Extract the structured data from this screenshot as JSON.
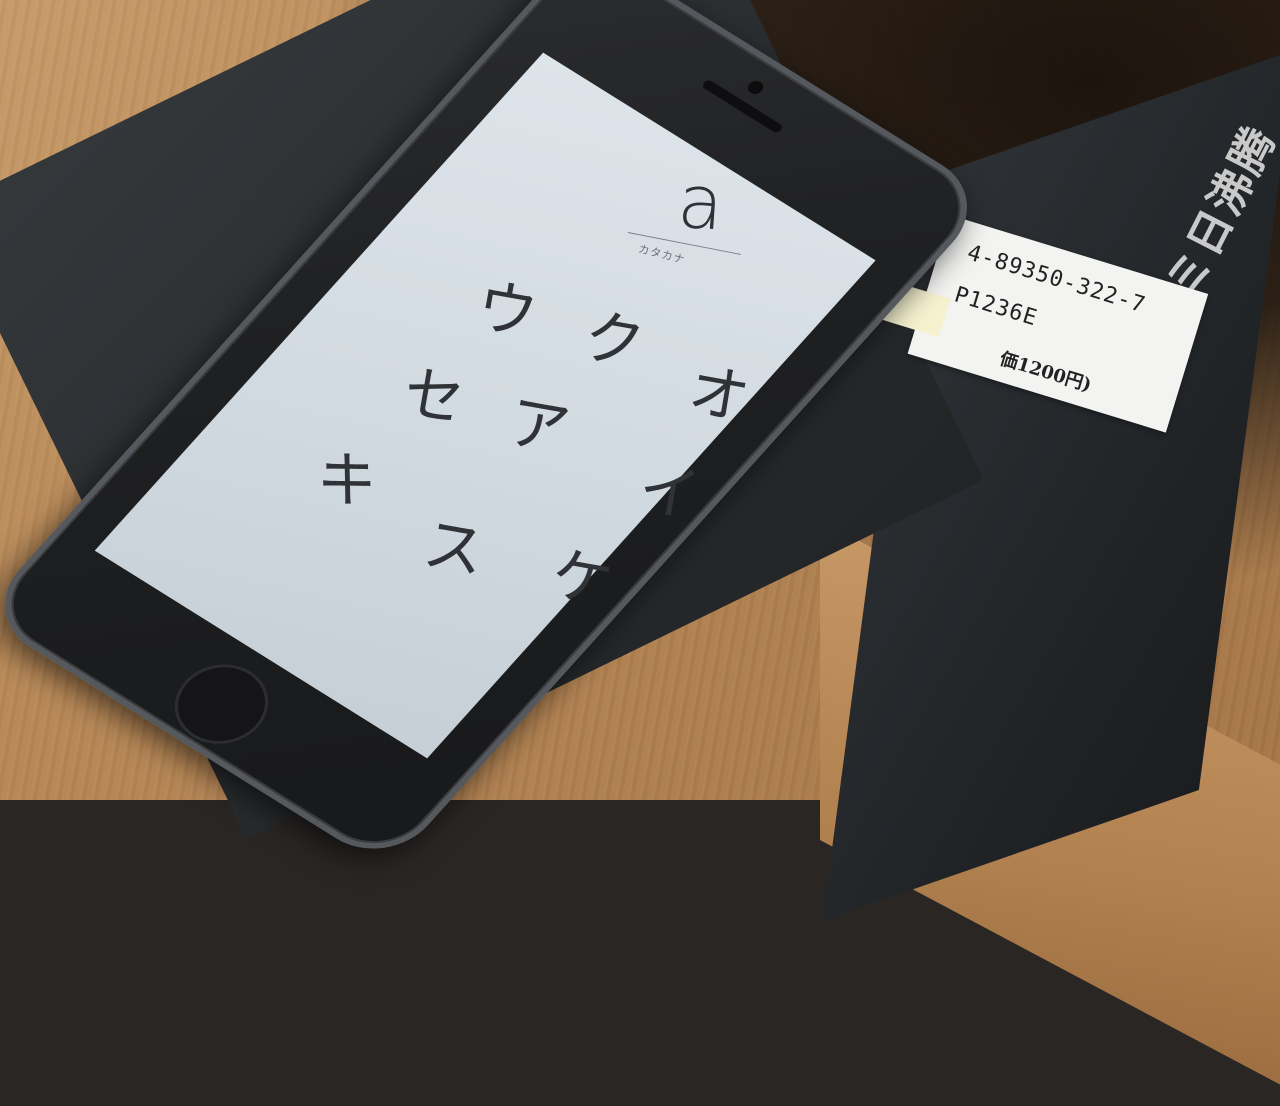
{
  "phone_app": {
    "current_letter": "a",
    "mode_label": "カタカナ",
    "kana_grid": [
      "ウ",
      "ク",
      "セ",
      "ア",
      "オ",
      "キ",
      "イ",
      "ス",
      "ケ"
    ]
  },
  "sticker": {
    "isbn_fragment": "4-89350-322-7",
    "code": "P1236E",
    "price": "価1200円)"
  },
  "book_spine": {
    "title_fragment": "ミス・ミ日沸腾"
  },
  "colors": {
    "screen": "#d8dfe5",
    "phone_body": "#1f2022",
    "table": "#b88856",
    "book": "#2b2e31"
  }
}
